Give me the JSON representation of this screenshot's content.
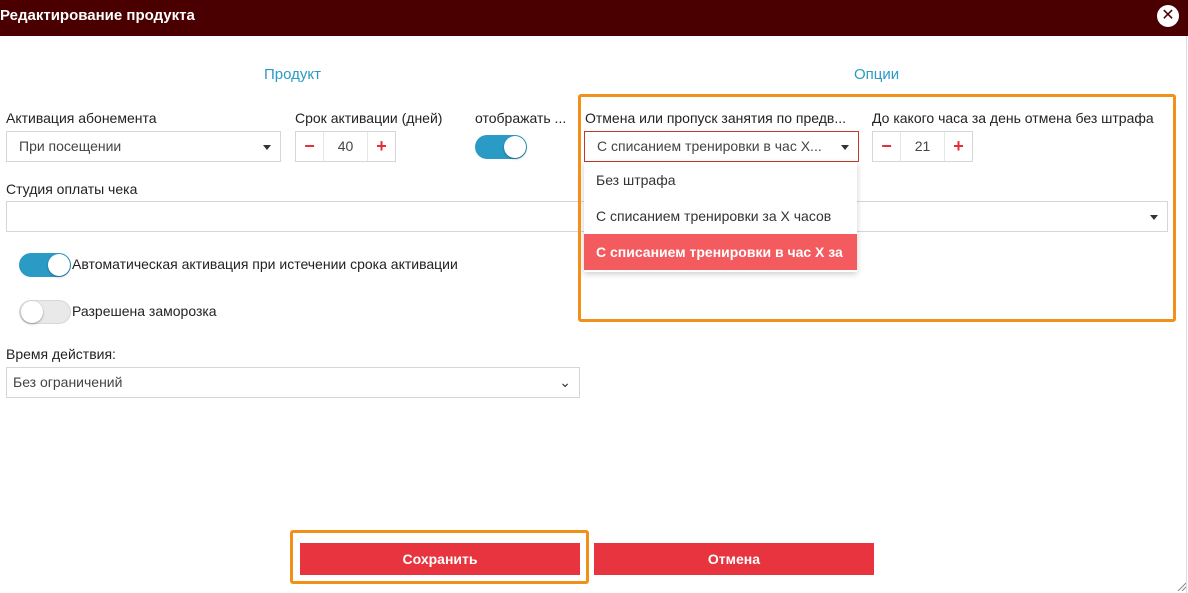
{
  "window": {
    "title": "Редактирование продукта",
    "close_icon": "close-icon"
  },
  "sections": {
    "product": "Продукт",
    "options": "Опции"
  },
  "subscription_activation": {
    "label": "Активация абонемента",
    "value": "При посещении"
  },
  "activation_period": {
    "label": "Срок активации (дней)",
    "value": "40",
    "minus": "−",
    "plus": "+"
  },
  "display_toggle": {
    "label": "отображать ...",
    "state": "on"
  },
  "cancellation": {
    "label": "Отмена или пропуск занятия по предв...",
    "value": "С списанием тренировки в час Х...",
    "options": [
      "Без штрафа",
      "С списанием тренировки за Х часов",
      "С списанием тренировки в час Х за"
    ],
    "selected_index": 2
  },
  "cancel_hour": {
    "label": "До какого часа за день отмена без штрафа",
    "value": "21",
    "minus": "−",
    "plus": "+"
  },
  "payment_studio": {
    "label": "Студия оплаты чека",
    "value": ""
  },
  "auto_activation": {
    "label": "Автоматическая активация при истечении срока активации",
    "state": "on"
  },
  "freeze_allowed": {
    "label": "Разрешена заморозка",
    "state": "off"
  },
  "validity": {
    "label": "Время действия:",
    "value": "Без ограничений"
  },
  "actions": {
    "save": "Сохранить",
    "cancel": "Отмена"
  },
  "colors": {
    "titlebar": "#4a0000",
    "accent": "#2a9bc4",
    "button": "#e8343f",
    "highlight": "#f39019",
    "selected_option": "#f35b5f"
  }
}
